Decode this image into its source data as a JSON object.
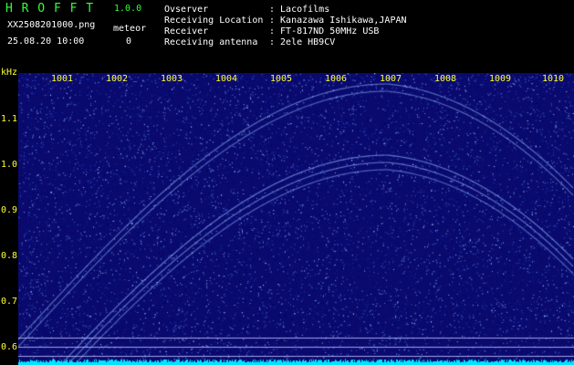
{
  "header": {
    "app_name": "H R O F F T",
    "version": "1.0.0",
    "filename": "XX2508201000.png",
    "datetime": "25.08.20 10:00",
    "meteor_label": "meteor",
    "meteor_count": "0"
  },
  "info": {
    "observer_label": "Ovserver",
    "observer_value": ": Lacofilms",
    "location_label": "Receiving Location",
    "location_value": ": Kanazawa Ishikawa,JAPAN",
    "receiver_label": "Receiver",
    "receiver_value": ": FT-817ND 50MHz USB",
    "antenna_label": "Receiving antenna",
    "antenna_value": ": 2ele HB9CV"
  },
  "axes": {
    "y_unit": "kHz",
    "y_ticks": [
      "1.1",
      "1.0",
      "0.9",
      "0.8",
      "0.7",
      "0.6"
    ],
    "x_ticks": [
      "1001",
      "1002",
      "1003",
      "1004",
      "1005",
      "1006",
      "1007",
      "1008",
      "1009",
      "1010"
    ]
  },
  "colors": {
    "background": "#000000",
    "spectrogram_bg": "#0a0a6e",
    "signal": "#7fb0ff",
    "baseline": "#00e5ff",
    "label_yellow": "#ffff33",
    "label_white": "#ffffff",
    "title_green": "#33ff33"
  }
}
